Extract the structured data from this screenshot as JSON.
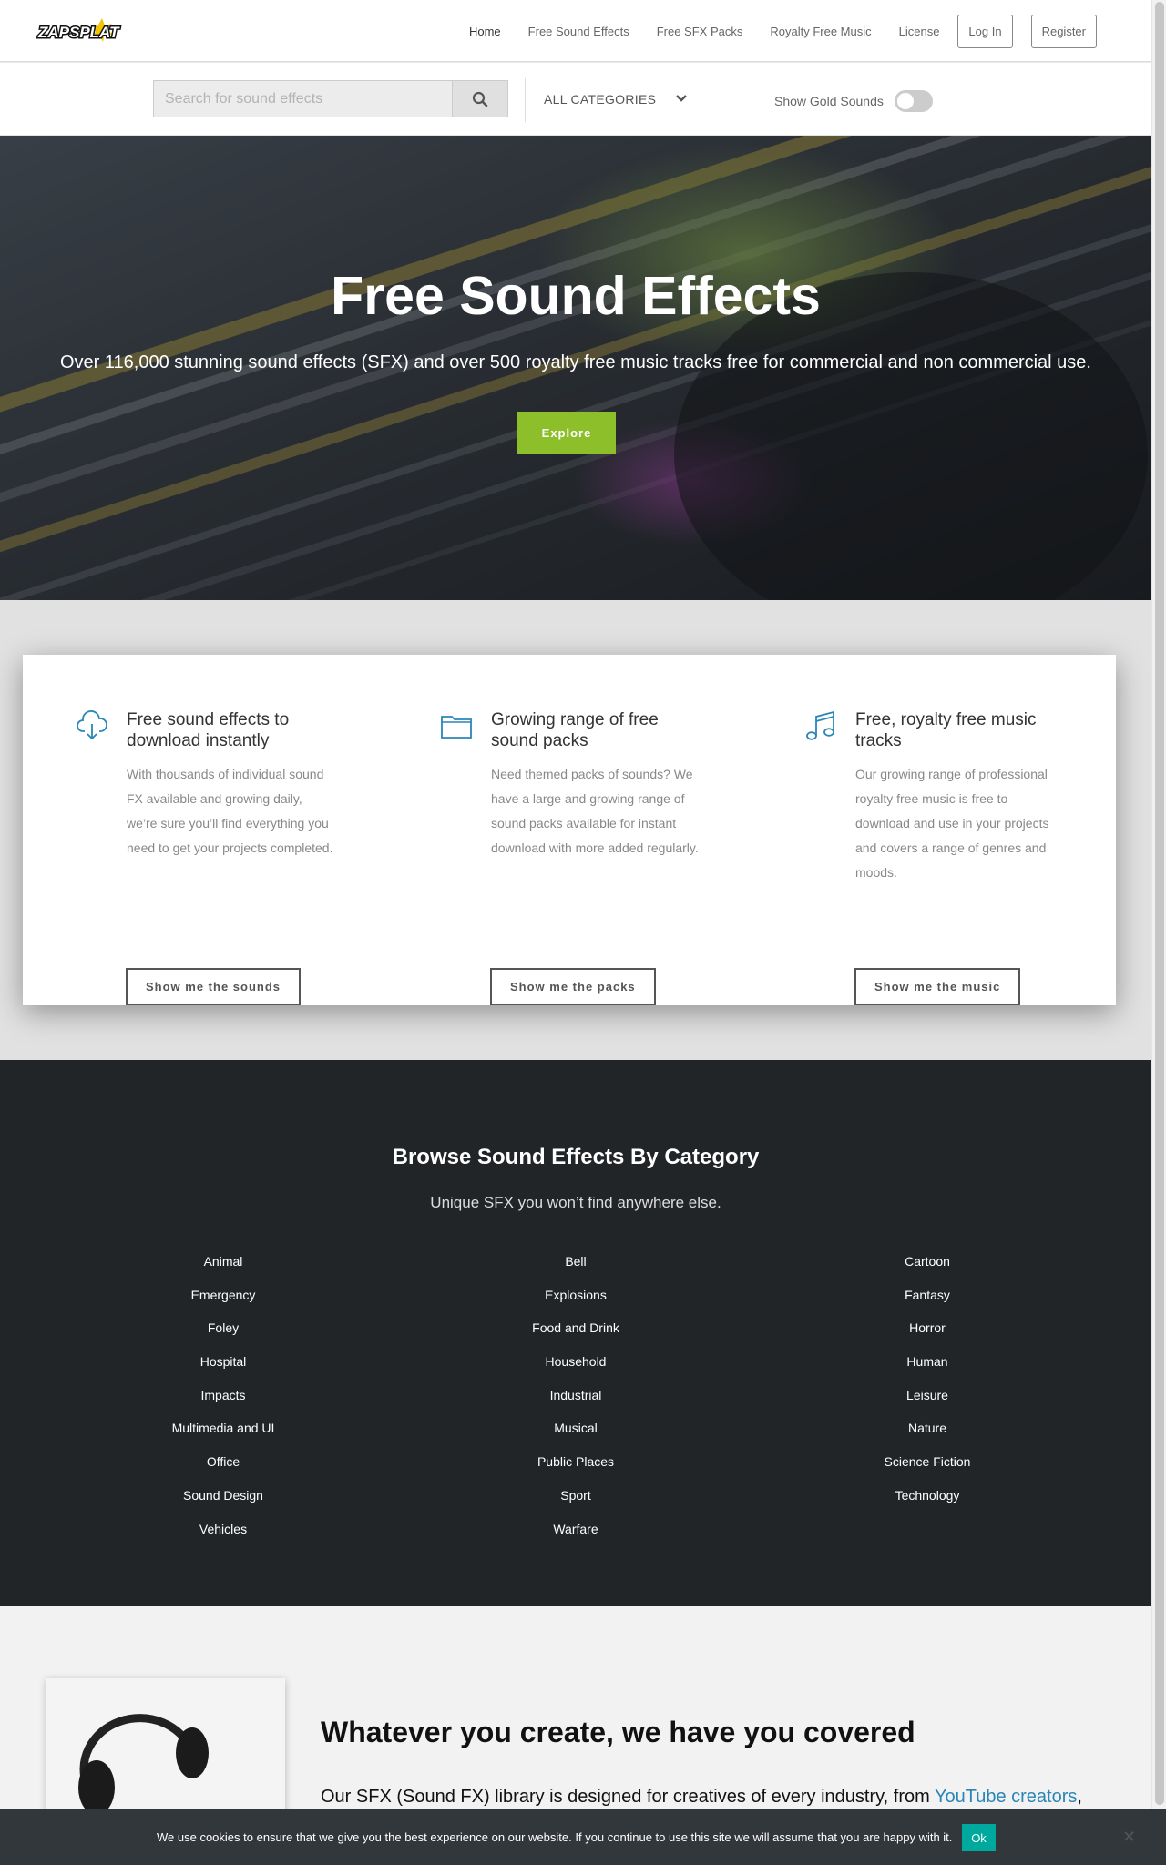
{
  "header": {
    "logo_text": "ZAPSPLAT",
    "nav": [
      {
        "label": "Home"
      },
      {
        "label": "Free Sound Effects"
      },
      {
        "label": "Free SFX Packs"
      },
      {
        "label": "Royalty Free Music"
      },
      {
        "label": "License"
      }
    ],
    "login_label": "Log In",
    "register_label": "Register"
  },
  "search": {
    "placeholder": "Search for sound effects",
    "value": "",
    "category_selected": "ALL CATEGORIES",
    "gold_label": "Show Gold Sounds",
    "gold_enabled": false
  },
  "hero": {
    "title": "Free Sound Effects",
    "subtitle": "Over 116,000 stunning sound effects (SFX) and over 500 royalty free music tracks free for commercial and non commercial use.",
    "button_label": "Explore",
    "button_color": "#8dbf2b"
  },
  "features": [
    {
      "icon": "cloud-download-icon",
      "title": "Free sound effects to download instantly",
      "desc": "With thousands of individual sound FX available and growing daily, we’re sure you’ll find everything you need to get your projects completed.",
      "button": "Show me the sounds"
    },
    {
      "icon": "folder-icon",
      "title": "Growing range of free sound packs",
      "desc": "Need themed packs of sounds? We have a large and growing range of sound packs available for instant download with more added regularly.",
      "button": "Show me the packs"
    },
    {
      "icon": "music-note-icon",
      "title": "Free, royalty free music tracks",
      "desc": "Our growing range of professional royalty free music is free to download and use in your projects and covers a range of genres and moods.",
      "button": "Show me the music"
    }
  ],
  "browse": {
    "title": "Browse Sound Effects By Category",
    "subtitle": "Unique SFX you won’t find anywhere else.",
    "columns": [
      [
        "Animal",
        "Emergency",
        "Foley",
        "Hospital",
        "Impacts",
        "Multimedia and UI",
        "Office",
        "Sound Design",
        "Vehicles"
      ],
      [
        "Bell",
        "Explosions",
        "Food and Drink",
        "Household",
        "Industrial",
        "Musical",
        "Public Places",
        "Sport",
        "Warfare"
      ],
      [
        "Cartoon",
        "Fantasy",
        "Horror",
        "Human",
        "Leisure",
        "Nature",
        "Science Fiction",
        "Technology"
      ]
    ]
  },
  "covered": {
    "title": "Whatever you create, we have you covered",
    "text_prefix": "Our SFX (Sound FX) library is designed for creatives of every industry, from ",
    "link": "YouTube creators",
    "text_suffix": ","
  },
  "cookie": {
    "message": "We use cookies to ensure that we give you the best experience on our website. If you continue to use this site we will assume that you are happy with it.",
    "ok_label": "Ok",
    "ok_color": "#00a99d"
  },
  "colors": {
    "accent_green": "#8dbf2b",
    "icon_blue": "#2a86b6",
    "dark_section": "#222528"
  }
}
